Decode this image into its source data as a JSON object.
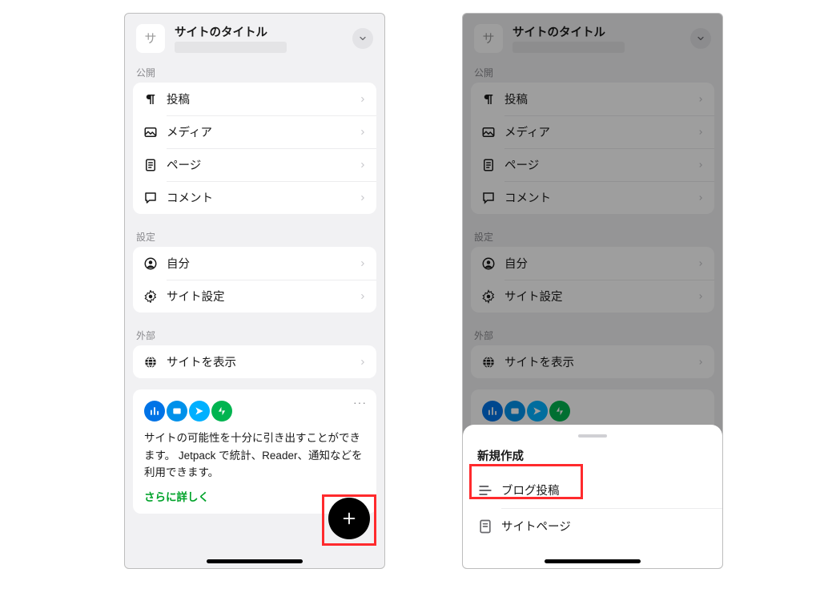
{
  "site": {
    "icon_letter": "サ",
    "title": "サイトのタイトル"
  },
  "sections": {
    "publish": {
      "label": "公開",
      "items": [
        {
          "key": "posts",
          "label": "投稿"
        },
        {
          "key": "media",
          "label": "メディア"
        },
        {
          "key": "pages",
          "label": "ページ"
        },
        {
          "key": "comments",
          "label": "コメント"
        }
      ]
    },
    "settings": {
      "label": "設定",
      "items": [
        {
          "key": "me",
          "label": "自分"
        },
        {
          "key": "site-settings",
          "label": "サイト設定"
        }
      ]
    },
    "external": {
      "label": "外部",
      "items": [
        {
          "key": "view-site",
          "label": "サイトを表示"
        }
      ]
    }
  },
  "promo": {
    "text": "サイトの可能性を十分に引き出すことができます。 Jetpack で統計、Reader、通知などを利用できます。",
    "link": "さらに詳しく"
  },
  "sheet": {
    "title": "新規作成",
    "items": [
      {
        "key": "blog-post",
        "label": "ブログ投稿"
      },
      {
        "key": "site-page",
        "label": "サイトページ"
      }
    ]
  }
}
